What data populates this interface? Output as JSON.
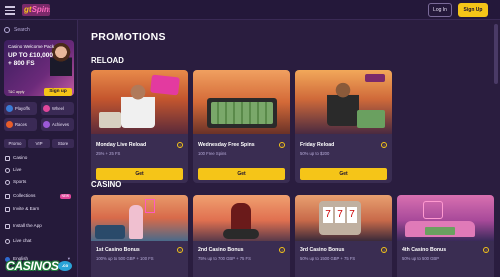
{
  "header": {
    "logo_a": "gt",
    "logo_b": "Spins",
    "login_label": "Log In",
    "signup_label": "Sign Up"
  },
  "sidebar": {
    "search_placeholder": "Search",
    "promo": {
      "title": "Casino Welcome Pack",
      "amount": "UP TO £10,000 + 800 FS",
      "button": "Sign up",
      "terms": "T&C apply"
    },
    "categories": [
      {
        "label": "Playoffs",
        "color": "#3a7bd5"
      },
      {
        "label": "Wheel",
        "color": "#e0479b"
      },
      {
        "label": "Races",
        "color": "#e85d2a"
      },
      {
        "label": "Achieves",
        "color": "#9b59d6"
      }
    ],
    "tabs": [
      "Promo",
      "VIP",
      "Store"
    ],
    "nav": [
      {
        "label": "Casino",
        "icon": "casino-icon"
      },
      {
        "label": "Live",
        "icon": "live-icon"
      },
      {
        "label": "Sports",
        "icon": "sports-icon"
      },
      {
        "label": "Collections",
        "icon": "collections-icon",
        "badge": "NEW"
      },
      {
        "label": "Invite & Earn",
        "icon": "invite-icon"
      },
      {
        "label": "Install the App",
        "icon": "install-icon"
      },
      {
        "label": "Live chat",
        "icon": "chat-icon"
      }
    ],
    "language": "English"
  },
  "watermark": {
    "word": "CASINOS",
    "tld": ".co"
  },
  "main": {
    "page_title": "PROMOTIONS",
    "reload_title": "RELOAD",
    "casino_title": "CASINO",
    "reload_cards": [
      {
        "title": "Monday Live Reload",
        "subtitle": "25% + 25 FS",
        "button": "Get",
        "theme": "monday"
      },
      {
        "title": "Wednesday Free Spins",
        "subtitle": "100 Free Spins",
        "button": "Get",
        "theme": "wednesday"
      },
      {
        "title": "Friday Reload",
        "subtitle": "50% up to $200",
        "button": "Get",
        "theme": "friday"
      }
    ],
    "casino_cards": [
      {
        "title": "1st Casino Bonus",
        "subtitle": "100% up to 500 GBP + 100 FS",
        "theme": "c1"
      },
      {
        "title": "2nd Casino Bonus",
        "subtitle": "75% up to 700 GBP + 75 FS",
        "theme": "c2"
      },
      {
        "title": "3rd Casino Bonus",
        "subtitle": "50% up to 1500 GBP + 75 FS",
        "theme": "c3"
      },
      {
        "title": "4th Casino Bonus",
        "subtitle": "50% up to 500 GBP",
        "theme": "c4"
      }
    ],
    "info_glyph": "!"
  },
  "colors": {
    "accent": "#f5c518",
    "background": "#2a1d3f",
    "card": "#3a2d52"
  }
}
